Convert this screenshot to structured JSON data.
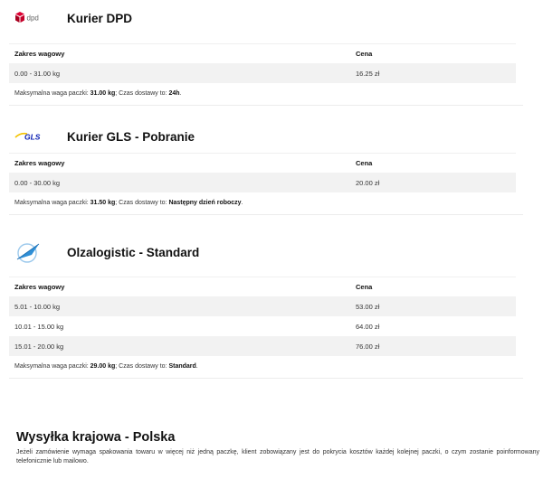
{
  "colors": {
    "dpd_red": "#dc0032",
    "gls_blue": "#061ab1",
    "gls_yellow": "#f4c300",
    "olza_blue": "#2f8fd6"
  },
  "carriers": [
    {
      "title": "Kurier DPD",
      "logo_text": "dpd",
      "logo_icon": "dpd-cube-icon",
      "header": {
        "range": "Zakres wagowy",
        "price": "Cena"
      },
      "rows": [
        {
          "range": "0.00 - 31.00 kg",
          "price": "16.25 zł"
        }
      ],
      "note": {
        "max_label": "Maksymalna waga paczki: ",
        "max_value": "31.00 kg",
        "sep": "; Czas dostawy to: ",
        "time_value": "24h",
        "end": "."
      }
    },
    {
      "title": "Kurier GLS - Pobranie",
      "logo_text": "GLS",
      "logo_icon": "gls-logo-icon",
      "header": {
        "range": "Zakres wagowy",
        "price": "Cena"
      },
      "rows": [
        {
          "range": "0.00 - 30.00 kg",
          "price": "20.00 zł"
        }
      ],
      "note": {
        "max_label": "Maksymalna waga paczki: ",
        "max_value": "31.50 kg",
        "sep": "; Czas dostawy to: ",
        "time_value": "Następny dzień roboczy",
        "end": "."
      }
    },
    {
      "title": "Olzalogistic - Standard",
      "logo_icon": "olzalogistic-plane-icon",
      "header": {
        "range": "Zakres wagowy",
        "price": "Cena"
      },
      "rows": [
        {
          "range": "5.01 - 10.00 kg",
          "price": "53.00 zł"
        },
        {
          "range": "10.01 - 15.00 kg",
          "price": "64.00 zł"
        },
        {
          "range": "15.01 - 20.00 kg",
          "price": "76.00 zł"
        }
      ],
      "note": {
        "max_label": "Maksymalna waga paczki: ",
        "max_value": "29.00 kg",
        "sep": "; Czas dostawy to: ",
        "time_value": "Standard",
        "end": "."
      }
    }
  ],
  "domestic": {
    "title": "Wysyłka krajowa - Polska",
    "text": "Jeżeli zamówienie wymaga spakowania towaru w więcej niż jedną paczkę, klient zobowiązany jest do pokrycia kosztów każdej kolejnej paczki, o czym zostanie poinformowany telefonicznie lub mailowo."
  }
}
